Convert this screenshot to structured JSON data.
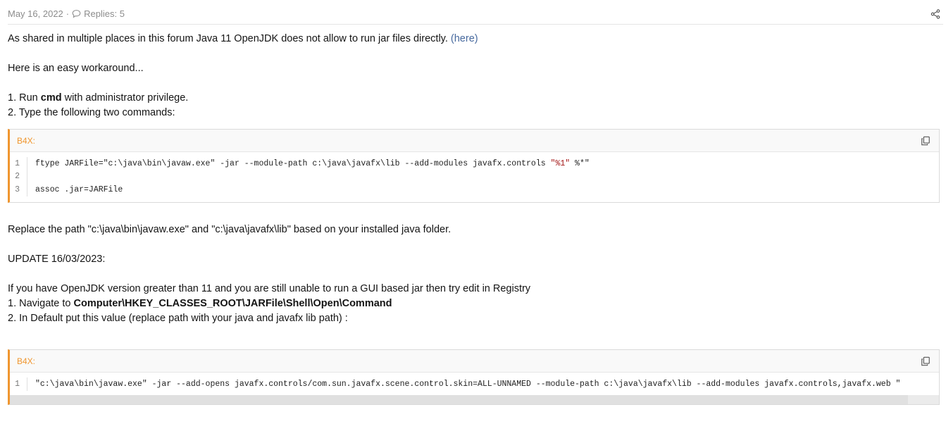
{
  "post": {
    "date": "May 16, 2022",
    "separator": "·",
    "replies": "Replies: 5"
  },
  "body": {
    "p1_text": "As shared in multiple places in this forum Java 11 OpenJDK does not allow to run jar files directly. ",
    "p1_link": "(here)",
    "p2": "Here is an easy workaround...",
    "step1_pre": "1. Run ",
    "step1_bold": "cmd",
    "step1_post": " with administrator privilege.",
    "step2": "2. Type the following two commands:",
    "p_replace": "Replace the path \"c:\\java\\bin\\javaw.exe\" and \"c:\\java\\javafx\\lib\" based on your installed java folder.",
    "update": "UPDATE 16/03/2023:",
    "p_openjdk": "If you have OpenJDK version greater than 11 and you are still unable to run a GUI based jar then try edit in Registry",
    "nav_pre": "1. Navigate to ",
    "nav_bold": "Computer\\HKEY_CLASSES_ROOT\\JARFile\\Shell\\Open\\Command",
    "default_line": "2. In Default put this value (replace path with your java and javafx lib path) :"
  },
  "code1": {
    "lang": "B4X:",
    "lines": [
      {
        "n": "1",
        "a": "ftype JARFile=\"c:\\java\\bin\\javaw.exe\" -jar --module-path c:\\java\\javafx\\lib --add-modules javafx.controls ",
        "s": "\"%1\"",
        "b": " %*\""
      },
      {
        "n": "2",
        "a": "",
        "s": "",
        "b": ""
      },
      {
        "n": "3",
        "a": "assoc .jar=JARFile",
        "s": "",
        "b": ""
      }
    ]
  },
  "code2": {
    "lang": "B4X:",
    "lines": [
      {
        "n": "1",
        "a": "\"c:\\java\\bin\\javaw.exe\" -jar --add-opens javafx.controls/com.sun.javafx.scene.control.skin=ALL-UNNAMED --module-path c:\\java\\javafx\\lib --add-modules javafx.controls,javafx.web \"",
        "s": "",
        "b": ""
      }
    ]
  },
  "icons": {
    "reply": "comment-icon",
    "share": "share-icon",
    "copy": "copy-icon"
  },
  "colors": {
    "accent": "#f0962f",
    "link": "#47699e",
    "meta": "#8c8c8c"
  }
}
